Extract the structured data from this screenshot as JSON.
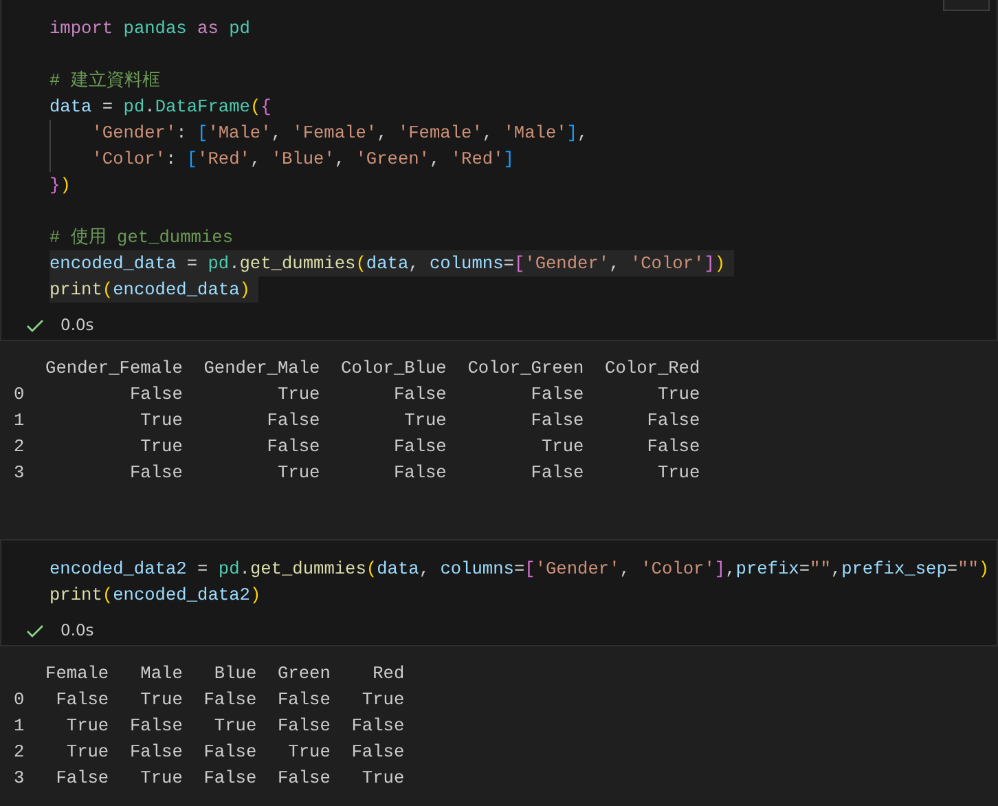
{
  "cells": [
    {
      "code": [
        {
          "kind": "code",
          "highlighted": false,
          "tokens": [
            {
              "text": "import ",
              "kind": "keyword"
            },
            {
              "text": "pandas ",
              "kind": "module"
            },
            {
              "text": "as ",
              "kind": "keyword"
            },
            {
              "text": "pd",
              "kind": "module"
            }
          ]
        },
        {
          "kind": "blank"
        },
        {
          "kind": "code",
          "highlighted": false,
          "tokens": [
            {
              "text": "# 建立資料框",
              "kind": "comment"
            }
          ]
        },
        {
          "kind": "code",
          "highlighted": false,
          "tokens": [
            {
              "text": "data",
              "kind": "variable"
            },
            {
              "text": " = ",
              "kind": "plain"
            },
            {
              "text": "pd",
              "kind": "module"
            },
            {
              "text": ".",
              "kind": "plain"
            },
            {
              "text": "DataFrame",
              "kind": "module"
            },
            {
              "text": "(",
              "kind": "bracket1"
            },
            {
              "text": "{",
              "kind": "bracket2"
            }
          ]
        },
        {
          "kind": "code",
          "highlighted": false,
          "indent_guide": true,
          "tokens": [
            {
              "text": "    'Gender'",
              "kind": "string"
            },
            {
              "text": ": ",
              "kind": "plain"
            },
            {
              "text": "[",
              "kind": "bracket3"
            },
            {
              "text": "'Male'",
              "kind": "string"
            },
            {
              "text": ", ",
              "kind": "plain"
            },
            {
              "text": "'Female'",
              "kind": "string"
            },
            {
              "text": ", ",
              "kind": "plain"
            },
            {
              "text": "'Female'",
              "kind": "string"
            },
            {
              "text": ", ",
              "kind": "plain"
            },
            {
              "text": "'Male'",
              "kind": "string"
            },
            {
              "text": "]",
              "kind": "bracket3"
            },
            {
              "text": ",",
              "kind": "plain"
            }
          ]
        },
        {
          "kind": "code",
          "highlighted": false,
          "indent_guide": true,
          "tokens": [
            {
              "text": "    'Color'",
              "kind": "string"
            },
            {
              "text": ": ",
              "kind": "plain"
            },
            {
              "text": "[",
              "kind": "bracket3"
            },
            {
              "text": "'Red'",
              "kind": "string"
            },
            {
              "text": ", ",
              "kind": "plain"
            },
            {
              "text": "'Blue'",
              "kind": "string"
            },
            {
              "text": ", ",
              "kind": "plain"
            },
            {
              "text": "'Green'",
              "kind": "string"
            },
            {
              "text": ", ",
              "kind": "plain"
            },
            {
              "text": "'Red'",
              "kind": "string"
            },
            {
              "text": "]",
              "kind": "bracket3"
            }
          ]
        },
        {
          "kind": "code",
          "highlighted": false,
          "tokens": [
            {
              "text": "}",
              "kind": "bracket2"
            },
            {
              "text": ")",
              "kind": "bracket1"
            }
          ]
        },
        {
          "kind": "blank"
        },
        {
          "kind": "code",
          "highlighted": false,
          "tokens": [
            {
              "text": "# 使用 get_dummies",
              "kind": "comment"
            }
          ]
        },
        {
          "kind": "code",
          "highlighted": true,
          "tokens": [
            {
              "text": "encoded_data",
              "kind": "variable"
            },
            {
              "text": " = ",
              "kind": "plain"
            },
            {
              "text": "pd",
              "kind": "module"
            },
            {
              "text": ".",
              "kind": "plain"
            },
            {
              "text": "get_dummies",
              "kind": "function"
            },
            {
              "text": "(",
              "kind": "bracket1"
            },
            {
              "text": "data",
              "kind": "variable"
            },
            {
              "text": ", ",
              "kind": "plain"
            },
            {
              "text": "columns",
              "kind": "variable"
            },
            {
              "text": "=",
              "kind": "plain"
            },
            {
              "text": "[",
              "kind": "bracket2"
            },
            {
              "text": "'Gender'",
              "kind": "string"
            },
            {
              "text": ", ",
              "kind": "plain"
            },
            {
              "text": "'Color'",
              "kind": "string"
            },
            {
              "text": "]",
              "kind": "bracket2"
            },
            {
              "text": ")",
              "kind": "bracket1"
            }
          ]
        },
        {
          "kind": "code",
          "highlighted": true,
          "tokens": [
            {
              "text": "print",
              "kind": "function"
            },
            {
              "text": "(",
              "kind": "bracket1"
            },
            {
              "text": "encoded_data",
              "kind": "variable"
            },
            {
              "text": ")",
              "kind": "bracket1"
            }
          ]
        }
      ],
      "status": {
        "success": true,
        "duration": "0.0s"
      },
      "output": [
        "   Gender_Female  Gender_Male  Color_Blue  Color_Green  Color_Red",
        "0          False         True       False        False       True",
        "1           True        False        True        False      False",
        "2           True        False       False         True      False",
        "3          False         True       False        False       True"
      ]
    },
    {
      "code": [
        {
          "kind": "code",
          "highlighted": false,
          "tokens": [
            {
              "text": "encoded_data2",
              "kind": "variable"
            },
            {
              "text": " = ",
              "kind": "plain"
            },
            {
              "text": "pd",
              "kind": "module"
            },
            {
              "text": ".",
              "kind": "plain"
            },
            {
              "text": "get_dummies",
              "kind": "function"
            },
            {
              "text": "(",
              "kind": "bracket1"
            },
            {
              "text": "data",
              "kind": "variable"
            },
            {
              "text": ", ",
              "kind": "plain"
            },
            {
              "text": "columns",
              "kind": "variable"
            },
            {
              "text": "=",
              "kind": "plain"
            },
            {
              "text": "[",
              "kind": "bracket2"
            },
            {
              "text": "'Gender'",
              "kind": "string"
            },
            {
              "text": ", ",
              "kind": "plain"
            },
            {
              "text": "'Color'",
              "kind": "string"
            },
            {
              "text": "]",
              "kind": "bracket2"
            },
            {
              "text": ",",
              "kind": "plain"
            },
            {
              "text": "prefix",
              "kind": "variable"
            },
            {
              "text": "=",
              "kind": "plain"
            },
            {
              "text": "\"\"",
              "kind": "string"
            },
            {
              "text": ",",
              "kind": "plain"
            },
            {
              "text": "prefix_sep",
              "kind": "variable"
            },
            {
              "text": "=",
              "kind": "plain"
            },
            {
              "text": "\"\"",
              "kind": "string"
            },
            {
              "text": ")",
              "kind": "bracket1"
            }
          ]
        },
        {
          "kind": "code",
          "highlighted": false,
          "tokens": [
            {
              "text": "print",
              "kind": "function"
            },
            {
              "text": "(",
              "kind": "bracket1"
            },
            {
              "text": "encoded_data2",
              "kind": "variable"
            },
            {
              "text": ")",
              "kind": "bracket1"
            }
          ]
        }
      ],
      "status": {
        "success": true,
        "duration": "0.0s"
      },
      "output": [
        "   Female   Male   Blue  Green    Red",
        "0   False   True  False  False   True",
        "1    True  False   True  False  False",
        "2    True  False  False   True  False",
        "3   False   True  False  False   True"
      ]
    }
  ]
}
